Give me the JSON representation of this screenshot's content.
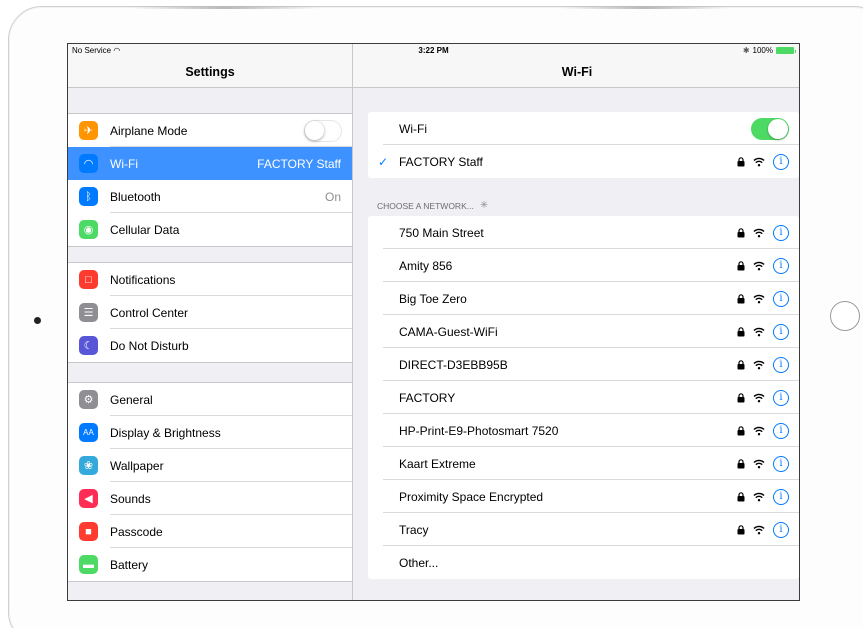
{
  "status_bar": {
    "carrier": "No Service",
    "time": "3:22 PM",
    "battery": "100%"
  },
  "master": {
    "title": "Settings",
    "groups": [
      [
        {
          "label": "Airplane Mode",
          "icon": "airplane-icon",
          "color": "#ff9500",
          "control": "toggle-off"
        },
        {
          "label": "Wi-Fi",
          "icon": "wifi-icon",
          "color": "#007aff",
          "value": "FACTORY Staff",
          "selected": true
        },
        {
          "label": "Bluetooth",
          "icon": "bluetooth-icon",
          "color": "#007aff",
          "value": "On"
        },
        {
          "label": "Cellular Data",
          "icon": "cellular-icon",
          "color": "#4cd964"
        }
      ],
      [
        {
          "label": "Notifications",
          "icon": "notifications-icon",
          "color": "#ff3b30"
        },
        {
          "label": "Control Center",
          "icon": "control-center-icon",
          "color": "#8e8e93"
        },
        {
          "label": "Do Not Disturb",
          "icon": "moon-icon",
          "color": "#5856d6"
        }
      ],
      [
        {
          "label": "General",
          "icon": "gear-icon",
          "color": "#8e8e93"
        },
        {
          "label": "Display & Brightness",
          "icon": "display-icon",
          "color": "#007aff"
        },
        {
          "label": "Wallpaper",
          "icon": "wallpaper-icon",
          "color": "#34aadc"
        },
        {
          "label": "Sounds",
          "icon": "sounds-icon",
          "color": "#ff2d55"
        },
        {
          "label": "Passcode",
          "icon": "lock-icon",
          "color": "#ff3b30"
        },
        {
          "label": "Battery",
          "icon": "battery-icon",
          "color": "#4cd964"
        }
      ]
    ]
  },
  "detail": {
    "title": "Wi-Fi",
    "wifi_label": "Wi-Fi",
    "wifi_on": true,
    "connected_network": "FACTORY Staff",
    "choose_header": "CHOOSE A NETWORK...",
    "networks": [
      "750 Main Street",
      "Amity 856",
      "Big Toe Zero",
      "CAMA-Guest-WiFi",
      "DIRECT-D3EBB95B",
      "FACTORY",
      "HP-Print-E9-Photosmart 7520",
      "Kaart Extreme",
      "Proximity Space Encrypted",
      "Tracy"
    ],
    "other_label": "Other..."
  },
  "colors": {
    "accent": "#007aff",
    "selected_row": "#3d92ff",
    "toggle_on": "#4cd964"
  }
}
